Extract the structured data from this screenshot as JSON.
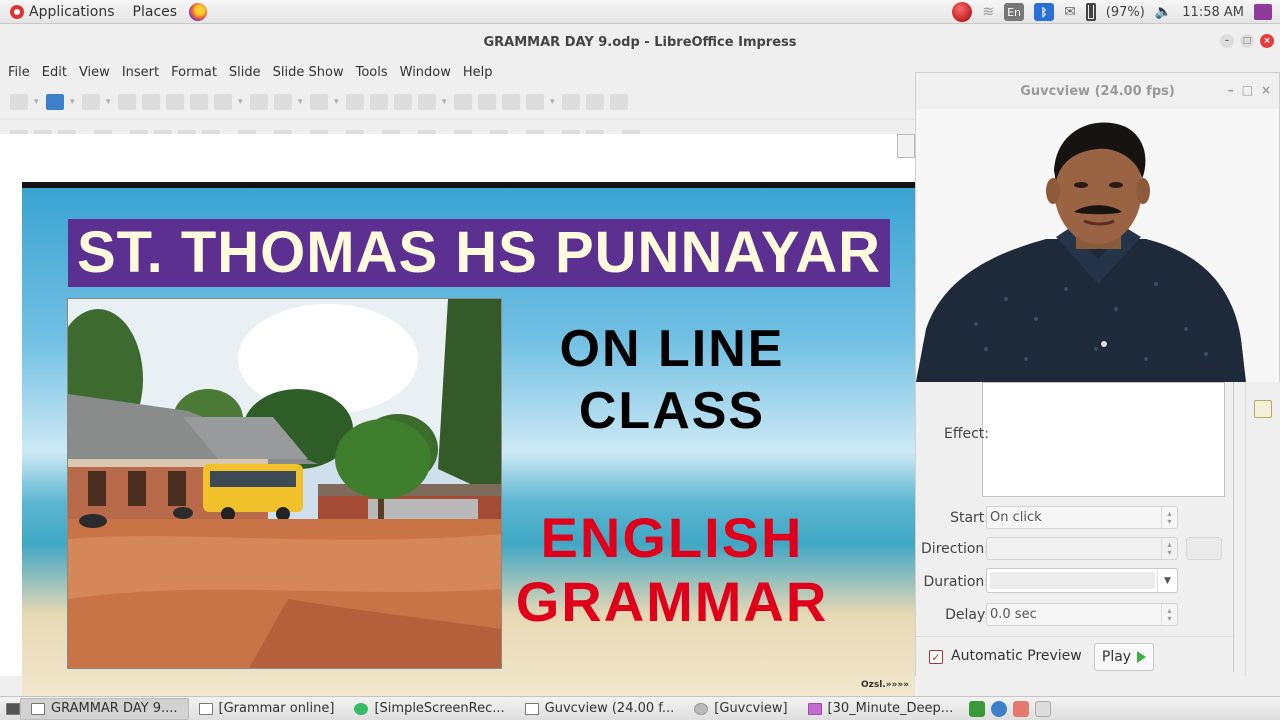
{
  "top_panel": {
    "applications": "Applications",
    "places": "Places",
    "keyboard_layout": "En",
    "bluetooth": "ᛒ",
    "battery": "(97%)",
    "clock": "11:58 AM"
  },
  "lo_window": {
    "title": "GRAMMAR DAY 9.odp - LibreOffice Impress",
    "menu": [
      "File",
      "Edit",
      "View",
      "Insert",
      "Format",
      "Slide",
      "Slide Show",
      "Tools",
      "Window",
      "Help"
    ]
  },
  "slide": {
    "title": "ST. THOMAS HS PUNNAYAR",
    "line1": "ON LINE",
    "line2": "CLASS",
    "line3": "ENGLISH",
    "line4": "GRAMMAR",
    "watermark": "Ozsl.»»»»",
    "colors": {
      "title_bg": "#5b3091",
      "title_text": "#fffadc",
      "red_text": "#e0001a"
    }
  },
  "guvcview": {
    "title": "Guvcview  (24.00 fps)"
  },
  "animation_panel": {
    "effect_label": "Effect:",
    "start_label": "Start:",
    "start_value": "On click",
    "direction_label": "Direction:",
    "duration_label": "Duration:",
    "delay_label": "Delay:",
    "delay_value": "0.0 sec",
    "auto_preview_label": "Automatic Preview",
    "auto_preview_checked": true,
    "play_label": "Play"
  },
  "taskbar": {
    "tasks": [
      "GRAMMAR DAY 9....",
      "[Grammar online]",
      "[SimpleScreenRec...",
      "Guvcview  (24.00 f...",
      "[Guvcview]",
      "[30_Minute_Deep..."
    ]
  }
}
